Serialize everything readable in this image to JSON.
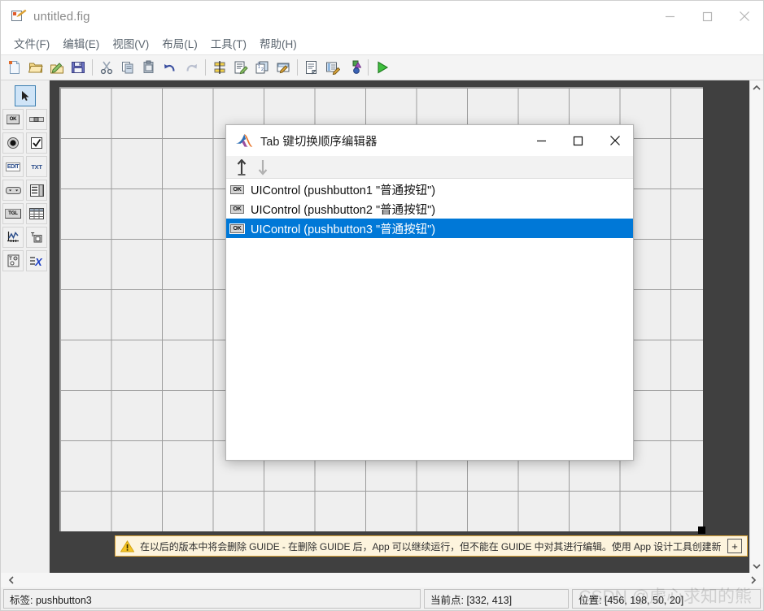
{
  "window": {
    "title": "untitled.fig",
    "icon": "figure-file-icon",
    "controls": [
      {
        "name": "minimize-button",
        "glyph": "minimize-icon"
      },
      {
        "name": "maximize-button",
        "glyph": "maximize-icon"
      },
      {
        "name": "close-button",
        "glyph": "close-icon"
      }
    ]
  },
  "menubar": {
    "items": [
      {
        "label": "文件(F)",
        "name": "menu-file"
      },
      {
        "label": "编辑(E)",
        "name": "menu-edit"
      },
      {
        "label": "视图(V)",
        "name": "menu-view"
      },
      {
        "label": "布局(L)",
        "name": "menu-layout"
      },
      {
        "label": "工具(T)",
        "name": "menu-tools"
      },
      {
        "label": "帮助(H)",
        "name": "menu-help"
      }
    ]
  },
  "toolbar": {
    "buttons": [
      {
        "name": "new-figure-icon",
        "tip": "新建"
      },
      {
        "name": "open-folder-icon",
        "tip": "打开"
      },
      {
        "name": "open-in-editor-icon",
        "tip": "在编辑器中打开"
      },
      {
        "name": "save-icon",
        "tip": "保存"
      },
      {
        "name": "cut-icon",
        "tip": "剪切"
      },
      {
        "name": "copy-icon",
        "tip": "复制"
      },
      {
        "name": "paste-icon",
        "tip": "粘贴"
      },
      {
        "name": "undo-icon",
        "tip": "撤销"
      },
      {
        "name": "redo-icon",
        "tip": "重做"
      },
      {
        "name": "align-objects-icon",
        "tip": "对齐对象"
      },
      {
        "name": "menu-editor-icon",
        "tip": "菜单编辑器"
      },
      {
        "name": "tab-order-editor-icon",
        "tip": "Tab 键切换顺序编辑器"
      },
      {
        "name": "toolbar-editor-icon",
        "tip": "工具栏编辑器"
      },
      {
        "name": "m-file-editor-icon",
        "tip": "M 文件编辑器"
      },
      {
        "name": "property-inspector-icon",
        "tip": "属性检查器"
      },
      {
        "name": "object-browser-icon",
        "tip": "对象浏览器"
      },
      {
        "name": "run-icon",
        "tip": "运行"
      }
    ]
  },
  "palette": {
    "items": [
      {
        "name": "palette-select-arrow",
        "glyph": "arrow-icon",
        "selected": true
      },
      {
        "name": "palette-push-button",
        "glyph": "OK"
      },
      {
        "name": "palette-slider",
        "glyph": "slider-icon"
      },
      {
        "name": "palette-radio-button",
        "glyph": "radio-icon"
      },
      {
        "name": "palette-check-box",
        "glyph": "check-icon"
      },
      {
        "name": "palette-edit-text",
        "glyph": "EDIT"
      },
      {
        "name": "palette-static-text",
        "glyph": "TXT"
      },
      {
        "name": "palette-pop-up-menu",
        "glyph": "popup-icon"
      },
      {
        "name": "palette-listbox",
        "glyph": "listbox-icon"
      },
      {
        "name": "palette-toggle-button",
        "glyph": "TGL"
      },
      {
        "name": "palette-table",
        "glyph": "table-icon"
      },
      {
        "name": "palette-axes",
        "glyph": "axes-icon"
      },
      {
        "name": "palette-panel",
        "glyph": "panel-icon"
      },
      {
        "name": "palette-button-group",
        "glyph": "button-group-icon"
      },
      {
        "name": "palette-activex-control",
        "glyph": "activex-icon"
      }
    ]
  },
  "warning": {
    "icon": "warning-triangle-icon",
    "text": "在以后的版本中将会删除 GUIDE - 在删除 GUIDE 后，App 可以继续运行，但不能在 GUIDE 中对其进行编辑。使用 App 设计工具创建新 App。",
    "expand_label": "+"
  },
  "statusbar": {
    "tag_label": "标签: pushbutton3",
    "current_point_label": "当前点: [332, 413]",
    "position_label": "位置: [456, 198, 50, 20]"
  },
  "dialog": {
    "title": "Tab 键切换顺序编辑器",
    "logo": "matlab-logo-icon",
    "controls": [
      {
        "name": "dialog-minimize-button",
        "glyph": "minimize-icon"
      },
      {
        "name": "dialog-maximize-button",
        "glyph": "maximize-icon"
      },
      {
        "name": "dialog-close-button",
        "glyph": "close-icon"
      }
    ],
    "toolbar": {
      "move_up": {
        "name": "move-up-arrow-icon",
        "enabled": true
      },
      "move_down": {
        "name": "move-down-arrow-icon",
        "enabled": false
      }
    },
    "items": [
      {
        "icon_label": "OK",
        "label": "UIControl (pushbutton1 \"普通按钮\")",
        "selected": false
      },
      {
        "icon_label": "OK",
        "label": "UIControl (pushbutton2 \"普通按钮\")",
        "selected": false
      },
      {
        "icon_label": "OK",
        "label": "UIControl (pushbutton3 \"普通按钮\")",
        "selected": true
      }
    ]
  },
  "watermark": {
    "text": "CSDN @虚心求知的熊"
  },
  "colors": {
    "selection_blue": "#0078d7",
    "warning_bg": "#fdf4dd",
    "warning_border": "#e2a93a",
    "canvas_gray": "#efefef",
    "outside_dark": "#404040"
  }
}
